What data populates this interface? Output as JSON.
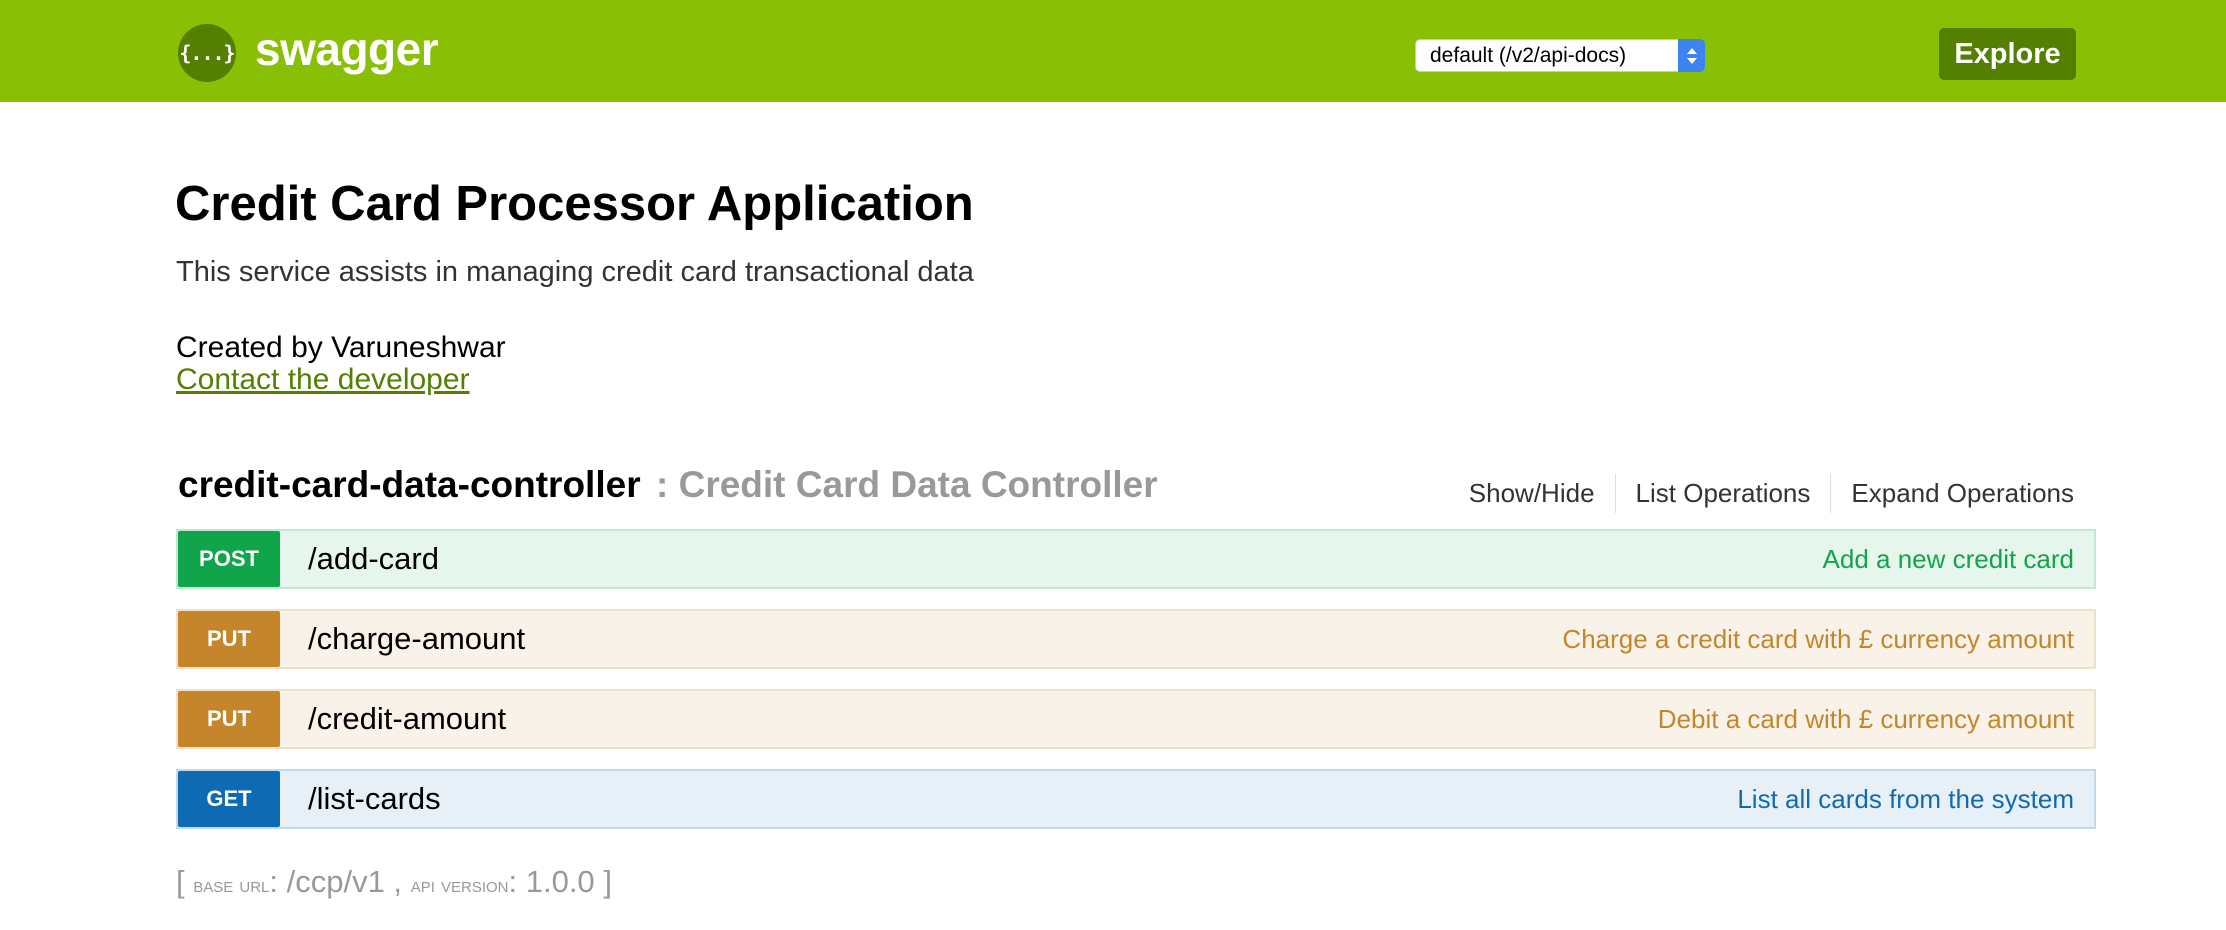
{
  "header": {
    "logo_icon": "{...}",
    "logo_text": "swagger",
    "api_select_value": "default (/v2/api-docs)",
    "explore_label": "Explore",
    "colors": {
      "bar": "#89bf04",
      "dark": "#547f00"
    }
  },
  "info": {
    "title": "Credit Card Processor Application",
    "description": "This service assists in managing credit card transactional data",
    "created_by": "Created by Varuneshwar",
    "contact_link": "Contact the developer"
  },
  "resource": {
    "name": "credit-card-data-controller",
    "description": ": Credit Card Data Controller",
    "links": [
      "Show/Hide",
      "List Operations",
      "Expand Operations"
    ]
  },
  "operations": [
    {
      "method": "POST",
      "path": "/add-card",
      "summary": "Add a new credit card",
      "color": "#10a54a"
    },
    {
      "method": "PUT",
      "path": "/charge-amount",
      "summary": "Charge a credit card with £ currency amount",
      "color": "#c5862b"
    },
    {
      "method": "PUT",
      "path": "/credit-amount",
      "summary": "Debit a card with £ currency amount",
      "color": "#c5862b"
    },
    {
      "method": "GET",
      "path": "/list-cards",
      "summary": "List all cards from the system",
      "color": "#0f6ab4"
    }
  ],
  "footer": {
    "open_bracket": "[",
    "base_url_label": "base url",
    "base_url_value": ": /ccp/v1 ,",
    "api_version_label": "api version",
    "api_version_value": ": 1.0.0",
    "close_bracket": "]"
  }
}
